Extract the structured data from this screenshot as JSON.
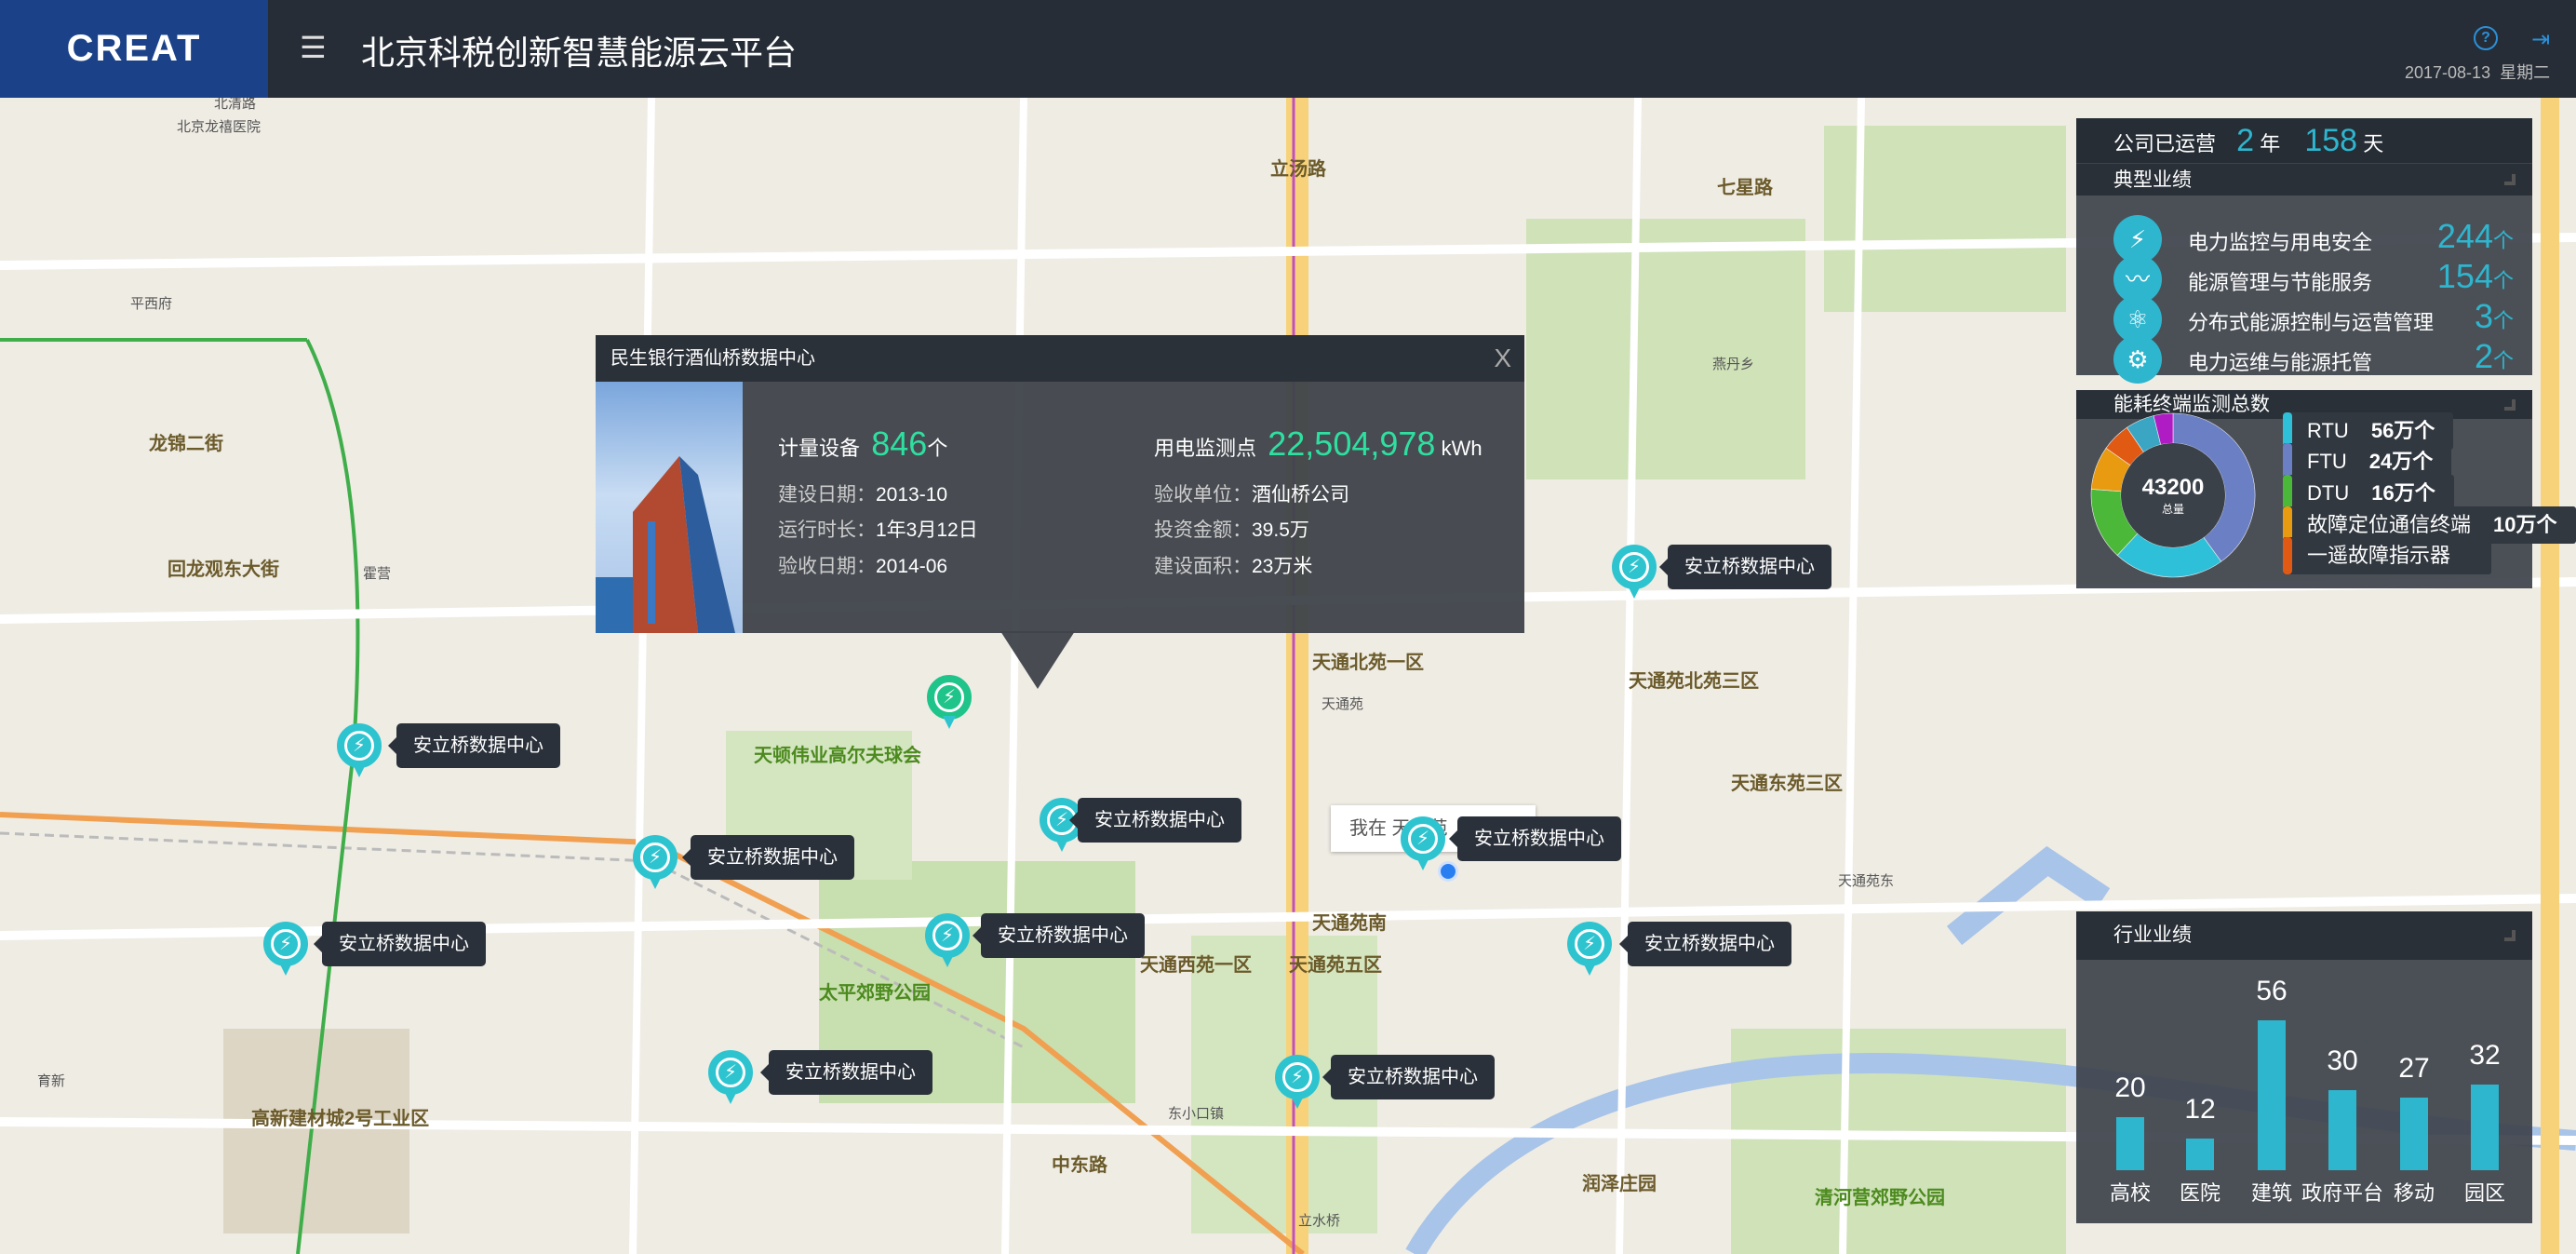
{
  "header": {
    "logo": "CREAT",
    "menu_icon": "menu-icon",
    "title": "北京科税创新智慧能源云平台",
    "help_icon": "?",
    "logout_icon": "logout-icon",
    "date": "2017-08-13",
    "weekday": "星期二"
  },
  "map": {
    "labels": [
      {
        "t": "北清路",
        "c": ""
      },
      {
        "t": "北京龙禧医院",
        "c": ""
      },
      {
        "t": "平西府",
        "c": ""
      },
      {
        "t": "龙锦二街",
        "c": "b"
      },
      {
        "t": "回龙观东大街",
        "c": "b"
      },
      {
        "t": "霍营",
        "c": ""
      },
      {
        "t": "育新",
        "c": ""
      },
      {
        "t": "天顿伟业高尔夫球会",
        "c": "g"
      },
      {
        "t": "太平郊野公园",
        "c": "g"
      },
      {
        "t": "高新建材城2号工业区",
        "c": "b"
      },
      {
        "t": "立汤路",
        "c": "b"
      },
      {
        "t": "天通北苑一区",
        "c": "b"
      },
      {
        "t": "天通苑",
        "c": ""
      },
      {
        "t": "天通苑南",
        "c": "b"
      },
      {
        "t": "天通苑北苑三区",
        "c": "b"
      },
      {
        "t": "天通东苑三区",
        "c": "b"
      },
      {
        "t": "天通西苑一区",
        "c": "b"
      },
      {
        "t": "天通苑五区",
        "c": "b"
      },
      {
        "t": "东小口镇",
        "c": ""
      },
      {
        "t": "中东路",
        "c": "b"
      },
      {
        "t": "立水桥",
        "c": ""
      },
      {
        "t": "燕丹乡",
        "c": ""
      },
      {
        "t": "七星路",
        "c": "b"
      },
      {
        "t": "清河营郊野公园",
        "c": "g"
      },
      {
        "t": "润泽庄园",
        "c": "b"
      },
      {
        "t": "天通苑东",
        "c": ""
      }
    ],
    "my_location": "我在 天通苑",
    "markers": [
      {
        "label": "安立桥数据中心"
      },
      {
        "label": "安立桥数据中心"
      },
      {
        "label": "安立桥数据中心"
      },
      {
        "label": "安立桥数据中心"
      },
      {
        "label": "安立桥数据中心"
      },
      {
        "label": "安立桥数据中心"
      },
      {
        "label": "安立桥数据中心"
      },
      {
        "label": "安立桥数据中心"
      },
      {
        "label": "安立桥数据中心"
      },
      {
        "label": "安立桥数据中心"
      }
    ],
    "marker_color": "#2ec4cf",
    "selected_marker_color": "#1fc48a"
  },
  "popup": {
    "title": "民生银行酒仙桥数据中心",
    "close": "X",
    "devices_label": "计量设备",
    "devices_value": "846",
    "devices_unit": "个",
    "points_label": "用电监测点",
    "points_value": "22,504,978",
    "points_unit": "kWh",
    "rows": [
      {
        "k": "建设日期：",
        "v": "2013-10"
      },
      {
        "k": "验收单位：",
        "v": "酒仙桥公司"
      },
      {
        "k": "运行时长：",
        "v": "1年3月12日"
      },
      {
        "k": "投资金额：",
        "v": "39.5万"
      },
      {
        "k": "验收日期：",
        "v": "2014-06"
      },
      {
        "k": "建设面积：",
        "v": "23万米"
      }
    ]
  },
  "operation": {
    "label": "公司已运营",
    "years": "2",
    "years_unit": "年",
    "days": "158",
    "days_unit": "天"
  },
  "typical": {
    "title": "典型业绩",
    "items": [
      {
        "icon": "lightning-icon",
        "glyph": "⚡",
        "label": "电力监控与用电安全",
        "value": "244",
        "unit": "个"
      },
      {
        "icon": "wave-icon",
        "glyph": "〰",
        "label": "能源管理与节能服务",
        "value": "154",
        "unit": "个"
      },
      {
        "icon": "atom-icon",
        "glyph": "⚛",
        "label": "分布式能源控制与运营管理",
        "value": "3",
        "unit": "个"
      },
      {
        "icon": "gear-icon",
        "glyph": "⚙",
        "label": "电力运维与能源托管",
        "value": "2",
        "unit": "个"
      }
    ]
  },
  "terminals": {
    "title": "能耗终端监测总数",
    "total": "43200",
    "total_label": "总量",
    "legend": [
      {
        "name": "RTU",
        "value": "56万个",
        "color": "#2ec0d8"
      },
      {
        "name": "FTU",
        "value": "24万个",
        "color": "#6b7fc4"
      },
      {
        "name": "DTU",
        "value": "16万个",
        "color": "#4cb83a"
      },
      {
        "name": "故障定位通信终端",
        "value": "10万个",
        "color": "#e89a10"
      },
      {
        "name": "一遥故障指示器",
        "value": "",
        "color": "#e05a14"
      }
    ]
  },
  "chart_data": [
    {
      "type": "pie",
      "donut": true,
      "center_text": "43200",
      "slices": [
        {
          "color": "#6b7fc4",
          "value": 42
        },
        {
          "color": "#2ec0d8",
          "value": 23
        },
        {
          "color": "#4cb83a",
          "value": 15
        },
        {
          "color": "#e89a10",
          "value": 9
        },
        {
          "color": "#e05a14",
          "value": 6
        },
        {
          "color": "#3aa6c4",
          "value": 6
        },
        {
          "color": "#b01cc4",
          "value": 4
        }
      ]
    },
    {
      "type": "bar",
      "title": "行业业绩",
      "categories": [
        "高校",
        "医院",
        "建筑",
        "政府平台",
        "移动",
        "园区"
      ],
      "values": [
        20,
        12,
        56,
        30,
        27,
        32
      ],
      "color": "#2eb6cf"
    }
  ]
}
